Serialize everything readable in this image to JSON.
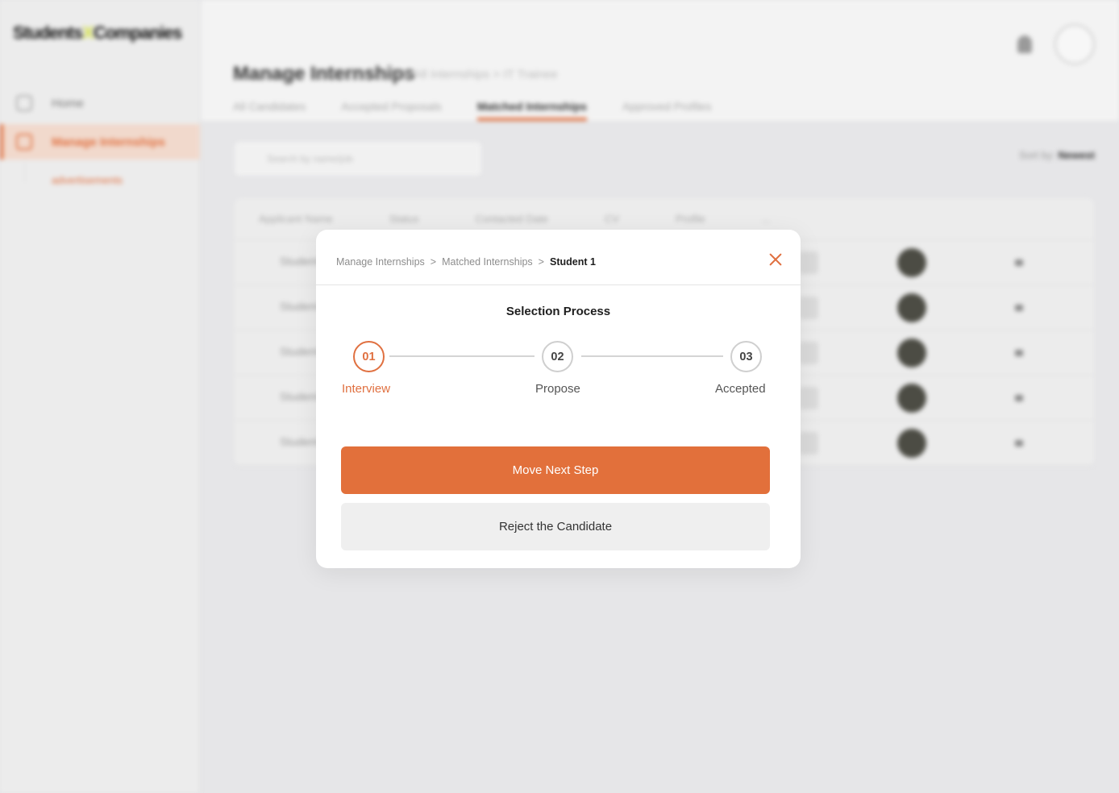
{
  "background": {
    "logo": {
      "left": "Students",
      "x": "X",
      "right": "Companies"
    },
    "sidebar": {
      "items": [
        {
          "label": "Home",
          "icon": "home-icon"
        },
        {
          "label": "Manage Internships",
          "icon": "briefcase-icon"
        }
      ],
      "sub_item": "advertisements"
    },
    "header": {
      "title": "Manage Internships",
      "crumbs": "> All Internships > IT Trainee",
      "tabs": [
        "All Candidates",
        "Accepted Proposals",
        "Matched Internships",
        "Approved Profiles"
      ],
      "active_tab": "Matched Internships"
    },
    "search_placeholder": "Search by name/job",
    "sort": {
      "label": "Sort by:",
      "value": "Newest"
    },
    "table": {
      "columns": [
        "Applicant Name",
        "Status",
        "Contacted Date",
        "CV",
        "Profile",
        "..."
      ],
      "rows": [
        "Student",
        "Student",
        "Student",
        "Student",
        "Student"
      ]
    }
  },
  "modal": {
    "breadcrumb": {
      "items": [
        "Manage Internships",
        "Matched Internships"
      ],
      "separator": ">",
      "current": "Student 1"
    },
    "title": "Selection Process",
    "steps": [
      {
        "number": "01",
        "label": "Interview"
      },
      {
        "number": "02",
        "label": "Propose"
      },
      {
        "number": "03",
        "label": "Accepted"
      }
    ],
    "active_step": 1,
    "primary_button": "Move Next Step",
    "secondary_button": "Reject the Candidate"
  },
  "colors": {
    "accent": "#e2703b",
    "overlay": "#e6e6e8"
  }
}
